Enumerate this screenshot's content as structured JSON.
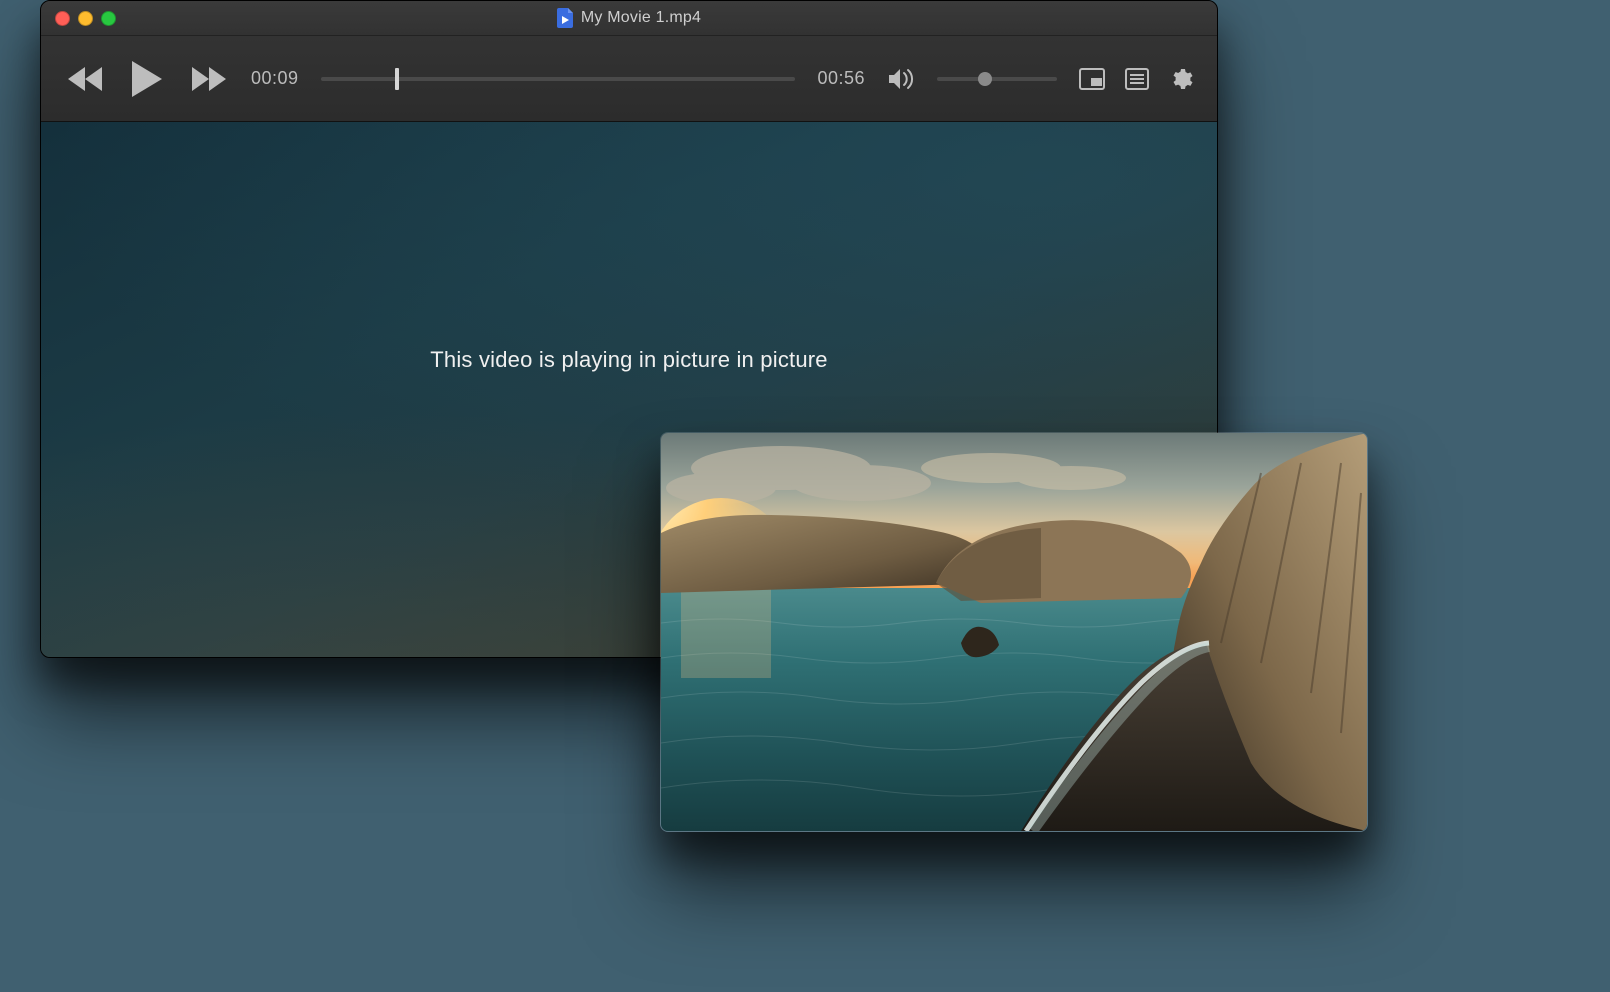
{
  "window": {
    "title": "My Movie 1.mp4"
  },
  "toolbar": {
    "current_time": "00:09",
    "duration": "00:56",
    "seek_percent": 16.07,
    "volume_percent": 40,
    "icons": {
      "rewind": "rewind-icon",
      "play": "play-icon",
      "fastforward": "fast-forward-icon",
      "volume": "volume-icon",
      "pip": "picture-in-picture-icon",
      "playlist": "playlist-icon",
      "settings": "gear-icon"
    }
  },
  "video_area": {
    "pip_message": "This video is playing in picture in picture"
  },
  "pip_window": {
    "description": "coastal cliffs at sunset",
    "draggable": true
  },
  "colors": {
    "chrome_bg": "#2f2f2f",
    "chrome_text": "#bcbcbc",
    "video_bg_dark": "#1c3b45",
    "traffic_red": "#ff5f57",
    "traffic_yellow": "#febc2e",
    "traffic_green": "#28c840"
  }
}
